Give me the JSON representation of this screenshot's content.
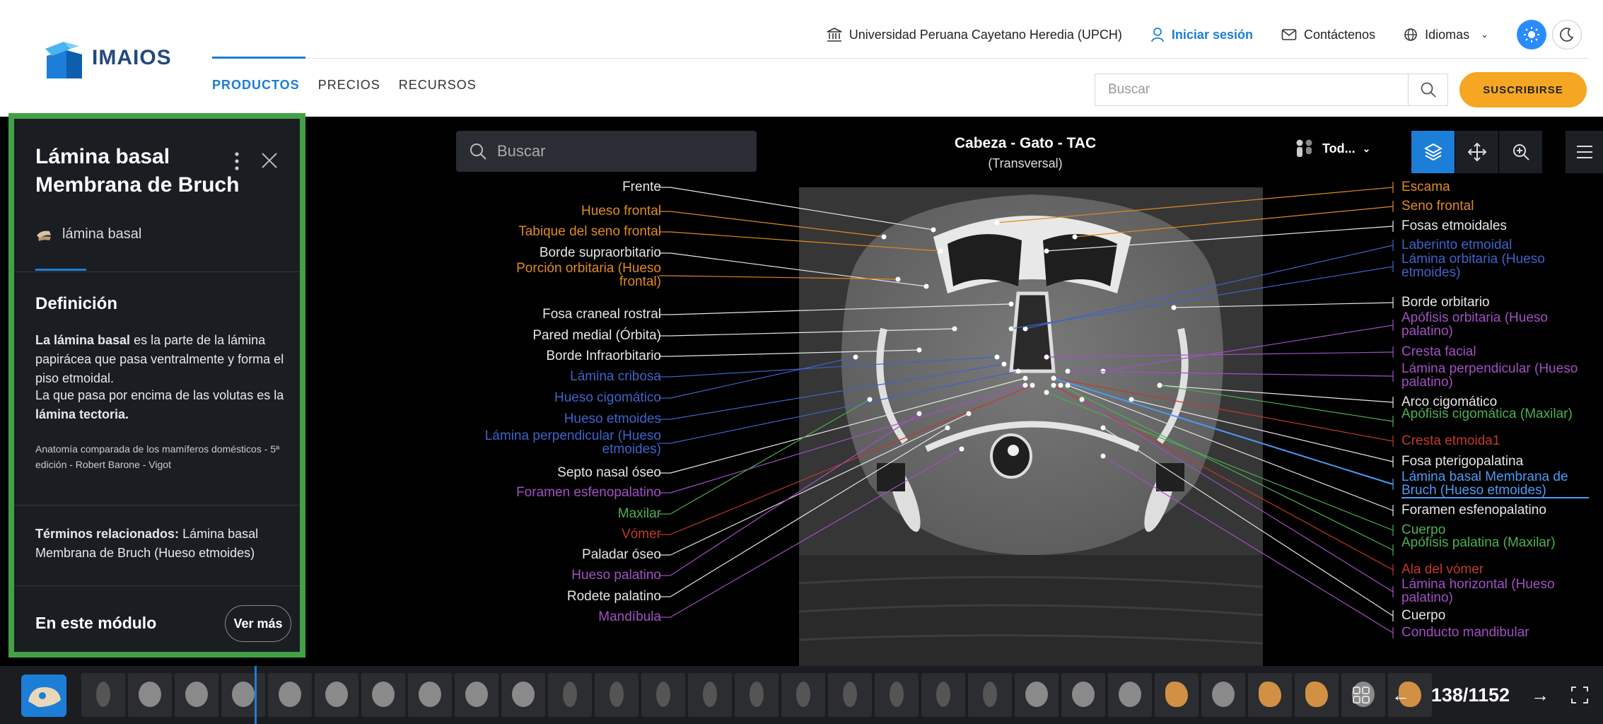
{
  "header": {
    "logo_text": "IMAIOS",
    "utility": {
      "institution": "Universidad Peruana Cayetano Heredia (UPCH)",
      "login": "Iniciar sesión",
      "contact": "Contáctenos",
      "language": "Idiomas"
    },
    "nav": [
      "PRODUCTOS",
      "PRECIOS",
      "RECURSOS"
    ],
    "search_placeholder": "Buscar",
    "subscribe": "SUSCRIBIRSE"
  },
  "viewer": {
    "search_placeholder": "Buscar",
    "title": "Cabeza - Gato - TAC",
    "subtitle": "(Transversal)",
    "filter_label": "Tod...",
    "slice_counter": "138/1152"
  },
  "colors": {
    "white": "#e6e6e6",
    "orange": "#e08a1e",
    "blue": "#3f63c9",
    "light_blue": "#4a9cf5",
    "green": "#4caf50",
    "purple": "#a24fc4",
    "red": "#c0392b",
    "accent": "#1c7ed6",
    "subscribe": "#f5a623",
    "panel_border": "#43a047"
  },
  "labels_left": [
    {
      "text": "Frente",
      "color": "white"
    },
    {
      "text": "Hueso frontal",
      "color": "orange"
    },
    {
      "text": "Tabique del seno frontal",
      "color": "orange"
    },
    {
      "text": "Borde supraorbitario",
      "color": "white"
    },
    {
      "text": "Porción orbitaria (Hueso frontal)",
      "color": "orange"
    },
    {
      "text": "Fosa craneal rostral",
      "color": "white"
    },
    {
      "text": "Pared medial (Órbita)",
      "color": "white"
    },
    {
      "text": "Borde Infraorbitario",
      "color": "white"
    },
    {
      "text": "Lámina cribosa",
      "color": "blue"
    },
    {
      "text": "Hueso cigomático",
      "color": "blue"
    },
    {
      "text": "Hueso etmoides",
      "color": "blue"
    },
    {
      "text": "Lámina perpendicular (Hueso etmoides)",
      "color": "blue"
    },
    {
      "text": "Septo nasal óseo",
      "color": "white"
    },
    {
      "text": "Foramen esfenopalatino",
      "color": "purple"
    },
    {
      "text": "Maxilar",
      "color": "green"
    },
    {
      "text": "Vómer",
      "color": "red"
    },
    {
      "text": "Paladar óseo",
      "color": "white"
    },
    {
      "text": "Hueso palatino",
      "color": "purple"
    },
    {
      "text": "Rodete palatino",
      "color": "white"
    },
    {
      "text": "Mandíbula",
      "color": "purple"
    }
  ],
  "labels_right": [
    {
      "text": "Escama",
      "color": "orange"
    },
    {
      "text": "Seno frontal",
      "color": "orange"
    },
    {
      "text": "Fosas etmoidales",
      "color": "white"
    },
    {
      "text": "Laberinto etmoidal",
      "color": "blue"
    },
    {
      "text": "Lámina orbitaria (Hueso etmoides)",
      "color": "blue"
    },
    {
      "text": "Borde orbitario",
      "color": "white"
    },
    {
      "text": "Apófisis orbitaria (Hueso palatino)",
      "color": "purple"
    },
    {
      "text": "Cresta facial",
      "color": "purple"
    },
    {
      "text": "Lámina perpendicular (Hueso palatino)",
      "color": "purple"
    },
    {
      "text": "Arco cigomático",
      "color": "white"
    },
    {
      "text": "Apófisis cigomática (Maxilar)",
      "color": "green"
    },
    {
      "text": "Cresta etmoida1",
      "color": "red"
    },
    {
      "text": "Fosa pterigopalatina",
      "color": "white"
    },
    {
      "text": "Lámina basal Membrana de Bruch (Hueso etmoides)",
      "color": "light_blue"
    },
    {
      "text": "Foramen esfenopalatino",
      "color": "white"
    },
    {
      "text": "Cuerpo",
      "color": "green"
    },
    {
      "text": "Apófisis palatina (Maxilar)",
      "color": "green"
    },
    {
      "text": "Ala del vómer",
      "color": "red"
    },
    {
      "text": "Lámina horizontal (Hueso palatino)",
      "color": "purple"
    },
    {
      "text": "Cuerpo",
      "color": "white"
    },
    {
      "text": "Conducto mandibular",
      "color": "purple"
    }
  ],
  "panel": {
    "title_line1": "Lámina basal",
    "title_line2": "Membrana de Bruch",
    "alt_term": "lámina basal",
    "definition_heading": "Definición",
    "def_p1_bold": "La lámina basal",
    "def_p1_rest": " es la parte de la lámina papirácea que pasa ventralmente y forma el piso etmoidal.",
    "def_p2_rest": "La que pasa por encima de las volutas es la ",
    "def_p2_bold": "lámina tectoria.",
    "reference": "Anatomía comparada de los mamíferos domésticos - 5ª edición - Robert Barone - Vigot",
    "related_bold": "Términos relacionados:",
    "related_rest": " Lámina basal Membrana de Bruch (Hueso etmoides)",
    "module_heading": "En este módulo",
    "more_button": "Ver más"
  }
}
